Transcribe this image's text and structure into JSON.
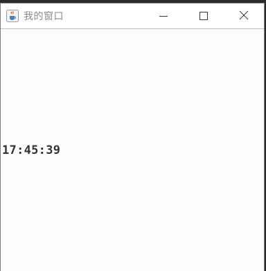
{
  "window": {
    "title": "我的窗口",
    "icon": "java-cup-icon",
    "controls": {
      "minimize": "minimize-icon",
      "maximize": "maximize-icon",
      "close": "close-icon"
    }
  },
  "content": {
    "clock_text": "17:45:39"
  }
}
